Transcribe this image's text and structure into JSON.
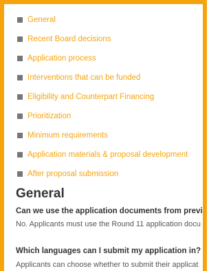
{
  "toc": {
    "items": [
      {
        "label": "General"
      },
      {
        "label": "Recent Board decisions"
      },
      {
        "label": "Application process"
      },
      {
        "label": "Interventions that can be funded"
      },
      {
        "label": "Eligibility and Counterpart Financing"
      },
      {
        "label": "Prioritization"
      },
      {
        "label": "Minimum requirements"
      },
      {
        "label": "Application materials & proposal development"
      },
      {
        "label": "After proposal submission"
      }
    ]
  },
  "section": {
    "heading": "General",
    "faq": [
      {
        "question": "Can we use the application documents from previo",
        "answer": "No. Applicants must use the Round 11 application docu"
      },
      {
        "question": "Which languages can I submit my application in?",
        "answer": "Applicants can choose whether to submit their applicat"
      }
    ]
  },
  "colors": {
    "accent": "#f5a40e",
    "bullet": "#777777",
    "heading": "#333333",
    "body_text": "#555555"
  }
}
